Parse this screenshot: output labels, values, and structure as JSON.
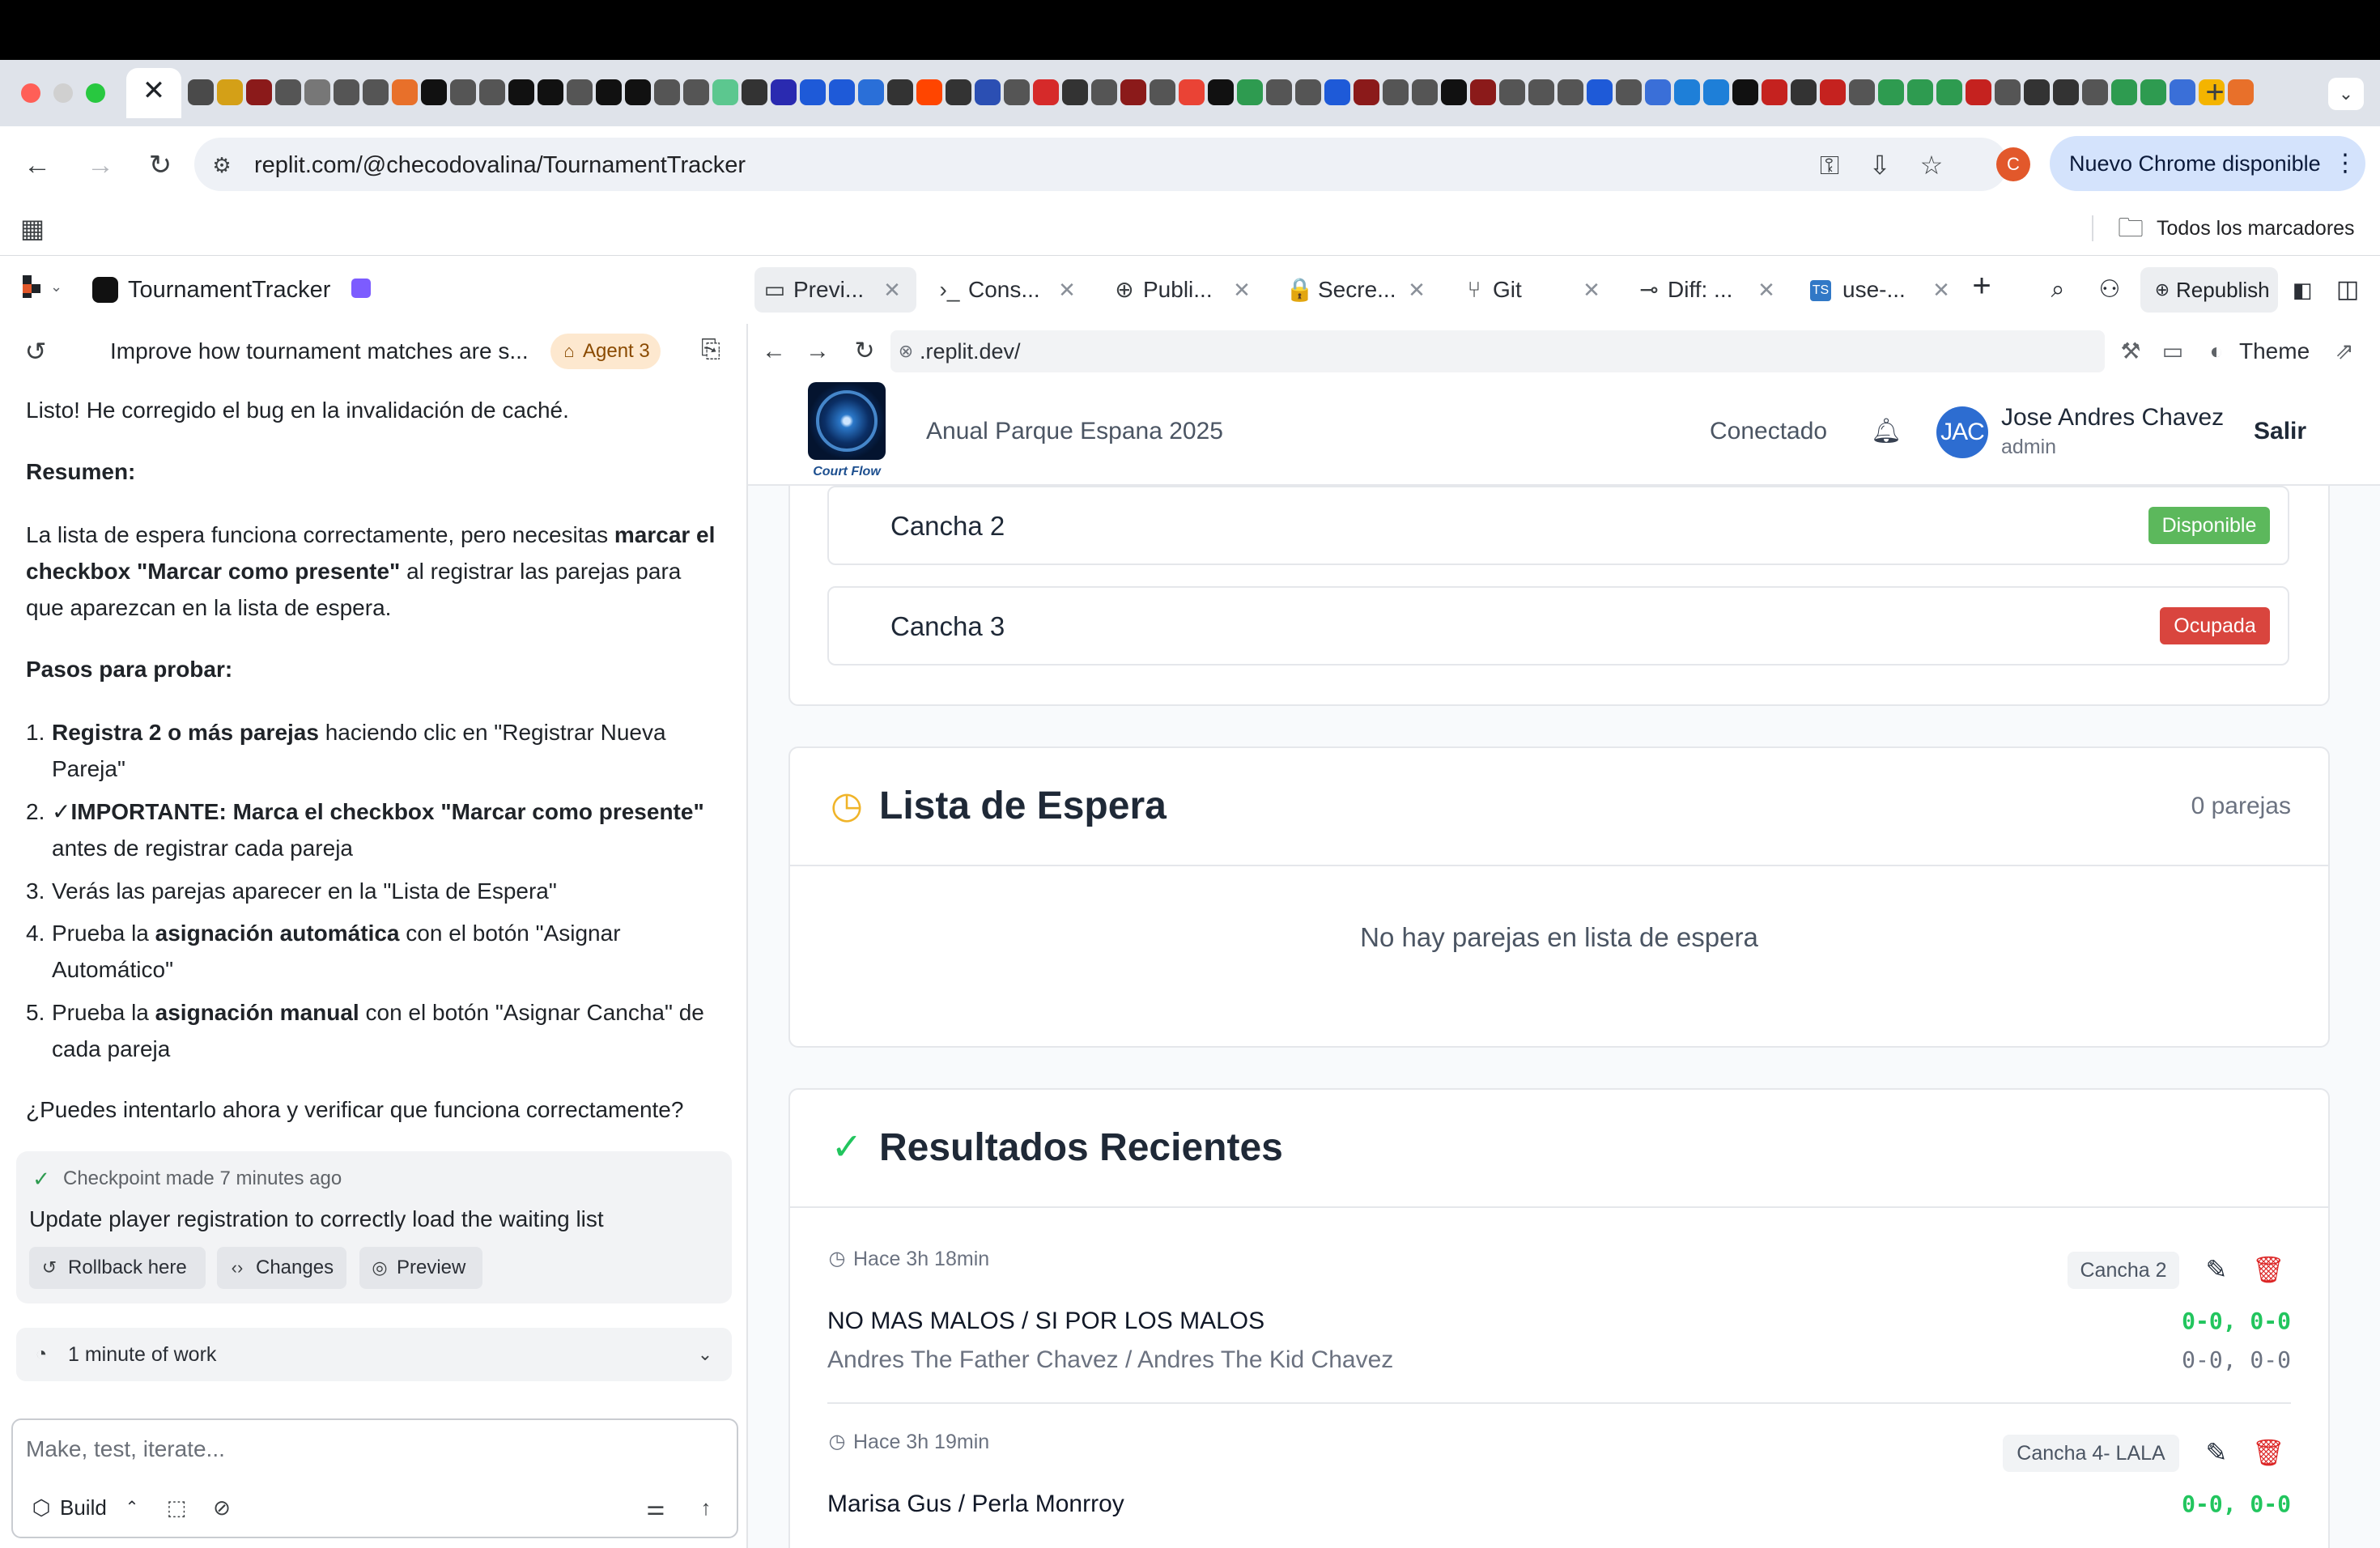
{
  "colors": {
    "available": "#5cb85c",
    "occupied": "#d9453e",
    "win_score": "#22c55e",
    "accent_clock": "#f0b429",
    "accent_check": "#22c55e",
    "avatar": "#2d6dd1"
  },
  "browser": {
    "tab_close": "✕",
    "new_tab": "+",
    "tab_search": "⌄",
    "url": "replit.com/@checodovalina/TournamentTracker",
    "profile_initial": "C",
    "update_label": "Nuevo Chrome disponible",
    "update_menu": "⋮",
    "bookmarks_label": "Todos los marcadores",
    "favicon_colors": [
      "#4a4a4a",
      "#d4a017",
      "#8b1a1a",
      "#555",
      "#777",
      "#555",
      "#555",
      "#e8702a",
      "#111",
      "#555",
      "#555",
      "#111",
      "#111",
      "#555",
      "#111",
      "#111",
      "#555",
      "#555",
      "#5cc78f",
      "#333",
      "#2a2ab0",
      "#1e5ad8",
      "#1e5ad8",
      "#2a6fd8",
      "#333",
      "#ff4500",
      "#333",
      "#2b4fb3",
      "#555",
      "#d62a2a",
      "#333",
      "#555",
      "#8b1a1a",
      "#555",
      "#ea4335",
      "#111",
      "#2e9b50",
      "#555",
      "#555",
      "#1e5ad8",
      "#8b1a1a",
      "#555",
      "#555",
      "#111",
      "#8b1a1a",
      "#555",
      "#555",
      "#555",
      "#1e5ad8",
      "#555",
      "#3a6fd8",
      "#1e7fd8",
      "#1e7fd8",
      "#111",
      "#c5221f",
      "#333",
      "#c5221f",
      "#555",
      "#2e9b50",
      "#2e9b50",
      "#2e9b50",
      "#c5221f",
      "#555",
      "#333",
      "#333",
      "#555",
      "#2e9b50",
      "#2e9b50",
      "#3a6fd8",
      "#f4b400",
      "#e8702a"
    ]
  },
  "workspace": {
    "project_name": "TournamentTracker",
    "tabs": [
      {
        "icon": "▭",
        "label": "Previ...",
        "close": "✕"
      },
      {
        "icon": "›_",
        "label": "Cons...",
        "close": "✕"
      },
      {
        "icon": "⊕",
        "label": "Publi...",
        "close": "✕"
      },
      {
        "icon": "🔒",
        "label": "Secre...",
        "close": "✕"
      },
      {
        "icon": "⑂",
        "label": "Git",
        "close": "✕"
      },
      {
        "icon": "⊸",
        "label": "Diff: ...",
        "close": "✕"
      },
      {
        "icon": "TS",
        "label": "use-...",
        "close": "✕"
      }
    ],
    "add_tab": "+",
    "republish_label": "Republish"
  },
  "chat": {
    "title": "Improve how tournament matches are s...",
    "agent_badge": "Agent 3",
    "p1": "Listo! He corregido el bug en la invalidación de caché.",
    "h_summary": "Resumen:",
    "p2_pre": "La lista de espera funciona correctamente, pero necesitas ",
    "p2_bold": "marcar el checkbox \"Marcar como presente\"",
    "p2_post": " al registrar las parejas para que aparezcan en la lista de espera.",
    "h_steps": "Pasos para probar:",
    "steps": [
      {
        "num": "1.",
        "bold": "Registra 2 o más parejas",
        "text": " haciendo clic en \"Registrar Nueva Pareja\""
      },
      {
        "num": "2.",
        "bold": "✓IMPORTANTE: Marca el checkbox \"Marcar como presente\"",
        "text": " antes de registrar cada pareja"
      },
      {
        "num": "3.",
        "pre": "Verás las parejas aparecer en la \"Lista de Espera\""
      },
      {
        "num": "4.",
        "pre": "Prueba la ",
        "bold": "asignación automática",
        "text": " con el botón \"Asignar Automático\""
      },
      {
        "num": "5.",
        "pre": "Prueba la ",
        "bold": "asignación manual",
        "text": " con el botón \"Asignar Cancha\" de cada pareja"
      }
    ],
    "question": "¿Puedes intentarlo ahora y verificar que funciona correctamente?",
    "checkpoint": {
      "meta": "Checkpoint made  7 minutes ago",
      "title": "Update player registration to correctly load the waiting list",
      "rollback": "Rollback here",
      "changes": "Changes",
      "preview": "Preview"
    },
    "work_label": "1 minute of work",
    "composer_placeholder": "Make, test, iterate...",
    "build_label": "Build"
  },
  "webview": {
    "url": ".replit.dev/",
    "theme_label": "Theme"
  },
  "app": {
    "logo_text": "Court Flow",
    "tournament": "Anual Parque Espana 2025",
    "connection": "Conectado",
    "avatar_initials": "JAC",
    "user_name": "Jose Andres Chavez",
    "user_role": "admin",
    "logout": "Salir",
    "courts": [
      {
        "name": "Cancha 2",
        "status": "Disponible"
      },
      {
        "name": "Cancha 3",
        "status": "Ocupada"
      }
    ],
    "waiting": {
      "title": "Lista de Espera",
      "count": "0 parejas",
      "empty": "No hay parejas en lista de espera"
    },
    "results": {
      "title": "Resultados Recientes",
      "items": [
        {
          "time": "Hace 3h 18min",
          "court": "Cancha 2",
          "team_a": "NO MAS MALOS / SI POR LOS MALOS",
          "score_a": "0-0, 0-0",
          "team_b": "Andres The Father Chavez / Andres The Kid Chavez",
          "score_b": "0-0, 0-0"
        },
        {
          "time": "Hace 3h 19min",
          "court": "Cancha 4- LALA",
          "team_a": "Marisa Gus / Perla Monrroy",
          "score_a": "0-0, 0-0"
        }
      ]
    }
  }
}
